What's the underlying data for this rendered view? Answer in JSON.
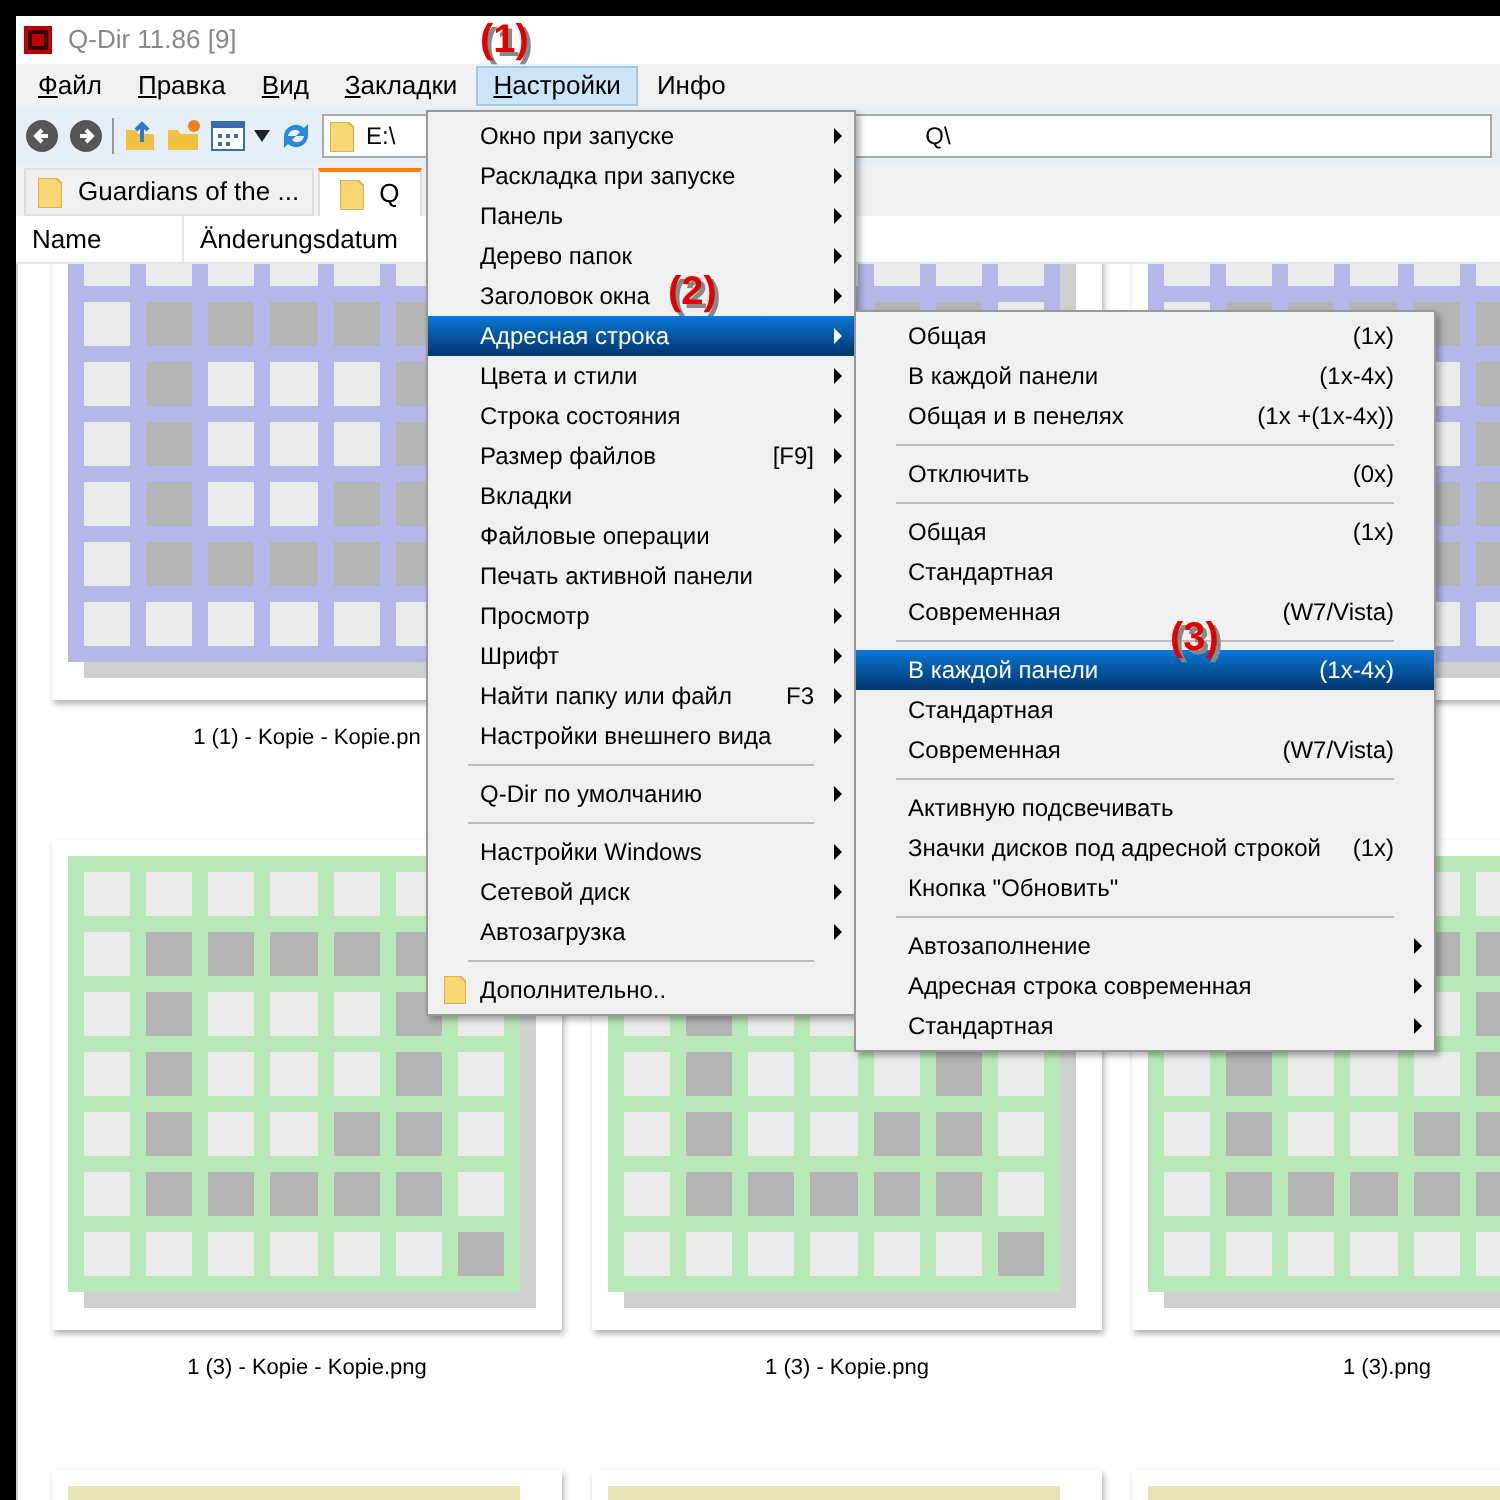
{
  "window": {
    "title": "Q-Dir 11.86 [9]"
  },
  "menu_bar": [
    {
      "label": "Файл",
      "mnemonic": true,
      "selected": false
    },
    {
      "label": "Правка",
      "mnemonic": true,
      "selected": false
    },
    {
      "label": "Вид",
      "mnemonic": true,
      "selected": false
    },
    {
      "label": "Закладки",
      "mnemonic": true,
      "selected": false
    },
    {
      "label": "Настройки",
      "mnemonic": true,
      "selected": true
    },
    {
      "label": "Инфо",
      "mnemonic": false,
      "selected": false
    }
  ],
  "address": {
    "start": "E:\\",
    "end": "Q\\"
  },
  "tabs": [
    {
      "label": "Guardians of the ...",
      "selected": false
    },
    {
      "label": "Q",
      "selected": true
    }
  ],
  "columns": [
    "Name",
    "Änderungsdatum"
  ],
  "thumbnails": [
    {
      "label": "1 (1) - Kopie - Kopie.pn",
      "color": "#b6b6e8"
    },
    {
      "color": "#b6b6e8"
    },
    {
      "color": "#b6b6e8"
    },
    {
      "label": "1 (3) - Kopie - Kopie.png",
      "color": "#b8e8b8"
    },
    {
      "label": "1 (3) - Kopie.png",
      "color": "#b8e8b8"
    },
    {
      "label": "1 (3).png",
      "color": "#b8e8b8"
    },
    {
      "color": "#e8e4b8"
    },
    {
      "color": "#e8e4b8"
    },
    {
      "color": "#e8e4b8"
    }
  ],
  "settings_menu": [
    {
      "kind": "item",
      "label": "Окно при запуске",
      "submenu": true,
      "selected": false
    },
    {
      "kind": "item",
      "label": "Раскладка при запуске",
      "submenu": true,
      "selected": false
    },
    {
      "kind": "item",
      "label": "Панель",
      "submenu": true,
      "selected": false
    },
    {
      "kind": "item",
      "label": "Дерево папок",
      "submenu": true,
      "selected": false
    },
    {
      "kind": "item",
      "label": "Заголовок окна",
      "submenu": true,
      "selected": false,
      "annotation": "(2)"
    },
    {
      "kind": "item",
      "label": "Адресная строка",
      "submenu": true,
      "selected": true
    },
    {
      "kind": "item",
      "label": "Цвета и стили",
      "submenu": true,
      "selected": false
    },
    {
      "kind": "item",
      "label": "Строка состояния",
      "submenu": true,
      "selected": false
    },
    {
      "kind": "item",
      "label": "Размер файлов",
      "shortcut": "[F9]",
      "submenu": true,
      "selected": false
    },
    {
      "kind": "item",
      "label": "Вкладки",
      "submenu": true,
      "selected": false
    },
    {
      "kind": "item",
      "label": "Файловые операции",
      "submenu": true,
      "selected": false
    },
    {
      "kind": "item",
      "label": "Печать активной панели",
      "submenu": true,
      "selected": false
    },
    {
      "kind": "item",
      "label": "Просмотр",
      "submenu": true,
      "selected": false
    },
    {
      "kind": "item",
      "label": "Шрифт",
      "submenu": true,
      "selected": false
    },
    {
      "kind": "item",
      "label": "Найти папку или файл",
      "shortcut": "F3",
      "submenu": true,
      "selected": false
    },
    {
      "kind": "item",
      "label": "Настройки внешнего вида",
      "submenu": true,
      "selected": false
    },
    {
      "kind": "separator"
    },
    {
      "kind": "item",
      "label": "Q-Dir по умолчанию",
      "submenu": true,
      "selected": false
    },
    {
      "kind": "separator"
    },
    {
      "kind": "item",
      "label": "Настройки Windows",
      "submenu": true,
      "selected": false
    },
    {
      "kind": "item",
      "label": "Сетевой диск",
      "submenu": true,
      "selected": false
    },
    {
      "kind": "item",
      "label": "Автозагрузка",
      "submenu": true,
      "selected": false
    },
    {
      "kind": "separator"
    },
    {
      "kind": "folder",
      "label": "Дополнительно..",
      "submenu": false,
      "selected": false
    }
  ],
  "address_submenu": [
    {
      "kind": "item",
      "label": "Общая",
      "shortcut": "(1x)",
      "submenu": false,
      "selected": false
    },
    {
      "kind": "item",
      "label": "В каждой панели",
      "shortcut": "(1x-4x)",
      "submenu": false,
      "selected": false
    },
    {
      "kind": "item",
      "label": "Общая и в пенелях",
      "shortcut": "(1x +(1x-4x))",
      "submenu": false,
      "selected": false
    },
    {
      "kind": "separator"
    },
    {
      "kind": "item",
      "label": "Отключить",
      "shortcut": "(0x)",
      "submenu": false,
      "selected": false
    },
    {
      "kind": "separator"
    },
    {
      "kind": "item",
      "label": "Общая",
      "shortcut": "(1x)",
      "submenu": false,
      "selected": false
    },
    {
      "kind": "item",
      "label": "Стандартная",
      "submenu": false,
      "selected": false
    },
    {
      "kind": "item",
      "label": "Современная",
      "shortcut": "(W7/Vista)",
      "submenu": false,
      "selected": false
    },
    {
      "kind": "separator"
    },
    {
      "kind": "item",
      "label": "В каждой панели",
      "shortcut": "(1x-4x)",
      "submenu": false,
      "selected": true
    },
    {
      "kind": "item",
      "label": "Стандартная",
      "submenu": false,
      "selected": false
    },
    {
      "kind": "item",
      "label": "Современная",
      "shortcut": "(W7/Vista)",
      "submenu": false,
      "selected": false
    },
    {
      "kind": "separator"
    },
    {
      "kind": "item",
      "label": "Активную подсвечивать",
      "submenu": false,
      "selected": false
    },
    {
      "kind": "item",
      "label": "Значки дисков под адресной строкой",
      "shortcut": "(1x)",
      "submenu": false,
      "selected": false
    },
    {
      "kind": "item",
      "label": "Кнопка \"Обновить\"",
      "submenu": false,
      "selected": false
    },
    {
      "kind": "separator"
    },
    {
      "kind": "item",
      "label": "Автозаполнение",
      "submenu": true,
      "selected": false
    },
    {
      "kind": "item",
      "label": "Адресная строка современная",
      "submenu": true,
      "selected": false
    },
    {
      "kind": "item",
      "label": "Стандартная",
      "submenu": true,
      "selected": false
    }
  ],
  "annotations": [
    "(1)",
    "(3)"
  ]
}
